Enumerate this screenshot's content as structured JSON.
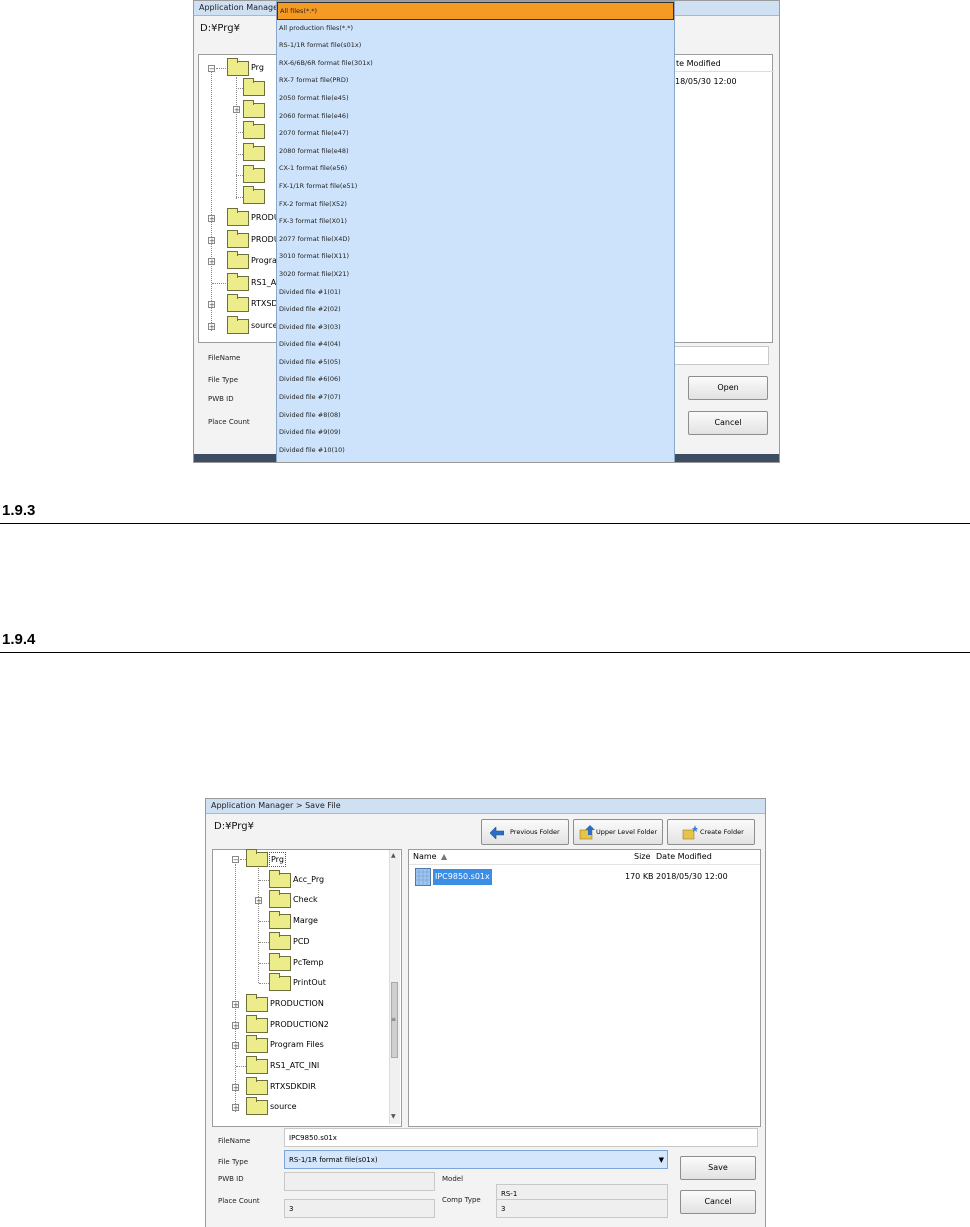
{
  "top_dialog": {
    "title": "Application Manage",
    "path": "D:¥Prg¥",
    "column_date_modified": "te Modified",
    "file_date": "18/05/30 12:00",
    "tree": [
      "Prg",
      "PRODU",
      "PRODU",
      "Progra",
      "RS1_A",
      "RTXSDI",
      "source"
    ],
    "labels": {
      "filename": "FileName",
      "file_type": "File Type",
      "pwb_id": "PWB ID",
      "place_count": "Place Count"
    },
    "open_label": "Open",
    "cancel_label": "Cancel",
    "dropdown_items": [
      "All files(*.*)",
      "All production files(*.*)",
      "RS-1/1R format file(s01x)",
      "RX-6/6B/6R format file(301x)",
      "RX-7 format file(PRD)",
      "2050 format file(e45)",
      "2060 format file(e46)",
      "2070 format file(e47)",
      "2080 format file(e48)",
      "CX-1 format file(e56)",
      "FX-1/1R format file(e51)",
      "FX-2 format file(X52)",
      "FX-3 format file(X01)",
      "2077 format file(X4D)",
      "3010 format file(X11)",
      "3020 format file(X21)",
      "Divided file #1(01)",
      "Divided file #2(02)",
      "Divided file #3(03)",
      "Divided file #4(04)",
      "Divided file #5(05)",
      "Divided file #6(06)",
      "Divided file #7(07)",
      "Divided file #8(08)",
      "Divided file #9(09)",
      "Divided file #10(10)"
    ]
  },
  "section_1": {
    "number": "1.9.3"
  },
  "section_2": {
    "number": "1.9.4"
  },
  "save_dialog": {
    "title": "Application Manager > Save File",
    "path": "D:¥Prg¥",
    "buttons": {
      "previous": "Previous Folder",
      "upper": "Upper Level Folder",
      "create": "Create Folder"
    },
    "tree": [
      {
        "label": "Prg",
        "selected": true
      },
      {
        "label": "Acc_Prg"
      },
      {
        "label": "Check"
      },
      {
        "label": "Marge"
      },
      {
        "label": "PCD"
      },
      {
        "label": "PcTemp"
      },
      {
        "label": "PrintOut"
      },
      {
        "label": "PRODUCTION"
      },
      {
        "label": "PRODUCTION2"
      },
      {
        "label": "Program Files"
      },
      {
        "label": "RS1_ATC_INI"
      },
      {
        "label": "RTXSDKDIR"
      },
      {
        "label": "source"
      }
    ],
    "list": {
      "col_name": "Name",
      "col_size": "Size",
      "col_date": "Date Modified",
      "rows": [
        {
          "name": "IPC9850.s01x",
          "size": "170 KB",
          "date": "2018/05/30 12:00"
        }
      ]
    },
    "labels": {
      "filename": "FileName",
      "file_type": "File Type",
      "pwb_id": "PWB ID",
      "model": "Model",
      "place_count": "Place Count",
      "comp_type": "Comp Type"
    },
    "values": {
      "filename": "IPC9850.s01x",
      "file_type": "RS-1/1R format file(s01x)",
      "model": "RS-1",
      "place_count": "3",
      "comp_type": "3"
    },
    "save_label": "Save",
    "cancel_label": "Cancel"
  },
  "colors": {
    "dropdown_bg": "#cde3fb",
    "selected_item": "#f59a23",
    "list_selection": "#3a8ee6"
  }
}
